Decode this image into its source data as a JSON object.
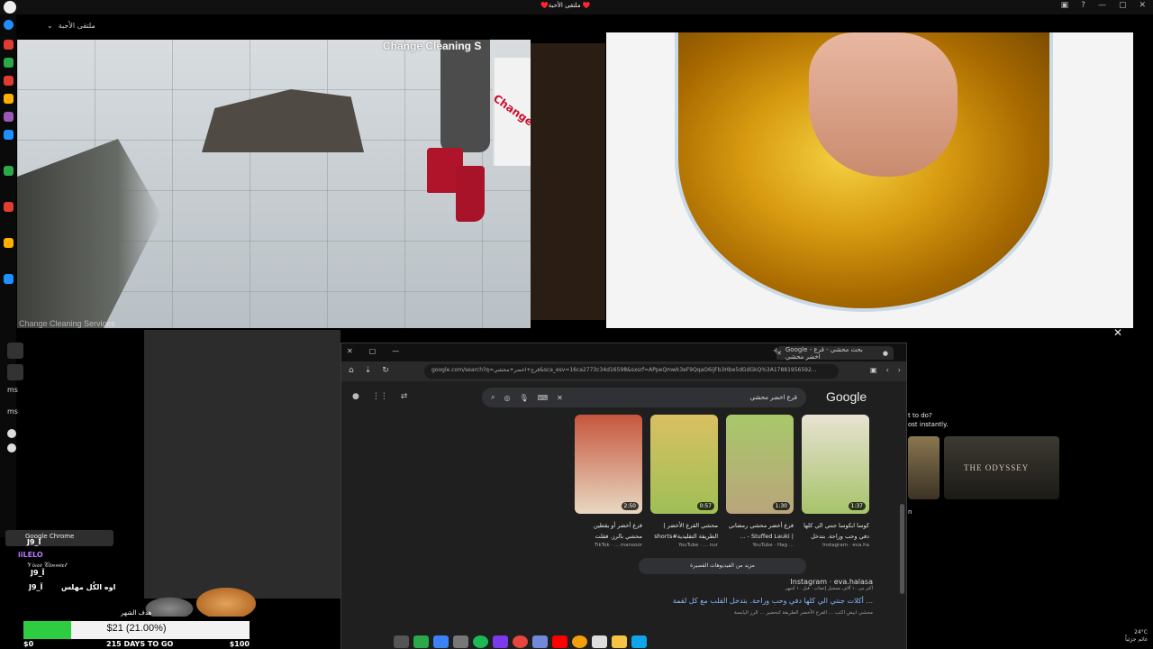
{
  "window": {
    "title": "♥️ملتقى الأحبة ♥️",
    "controls": [
      "▣",
      "?",
      "—",
      "▢",
      "✕"
    ]
  },
  "chat_header": {
    "room_name": "ملتقى الأحبة"
  },
  "video_left": {
    "brand_top": "Change Cleaning S",
    "sign_text": "Change Cle",
    "watermark": "Change Cleaning Services"
  },
  "browser": {
    "tab_title": "Google - بحث محشي - قرع اخضر محشي",
    "url": "google.com/search?q=قرع+اخضر+محشي&sca_esv=16ca2773c34d16598&sxsrf=APpeQmwk3eF9QqaO6ijFb3Hbe5dGdGkQ%3A17881956592...",
    "search_query": "قرع اخضر محشي",
    "logo": "Google",
    "videos": [
      {
        "title": "كوسا ابكوسا جنتي الي كلها دفي وحب وراحة. بتدخل القلب",
        "source": "Instagram · eva.ha",
        "duration": "1:37",
        "colors": [
          "#a7c36a",
          "#e8e2d2"
        ]
      },
      {
        "title": "قرع أخضر محشي رمضاني | Stuffed Lauki - ...",
        "source": "YouTube · Hag ... ",
        "duration": "1:30",
        "colors": [
          "#b9a57b",
          "#a8c86a"
        ]
      },
      {
        "title": "محشي القرع الأخضر | الطريقة التقليدية#shorts",
        "source": "YouTube · ... nur",
        "duration": "0:57",
        "colors": [
          "#9fbf56",
          "#d9c062"
        ]
      },
      {
        "title": "قرع أخضر أو يقطين محشي بالرز. فقلت البيتي...",
        "source": "TikTok · ... mansoor",
        "duration": "2:50",
        "colors": [
          "#e9d8c2",
          "#c5563c"
        ]
      }
    ],
    "more_videos": "مزيد من الفيديوهات القصيرة",
    "result": {
      "site": "Instagram · eva.halasa",
      "meta": "أكثر من ١٠ آلاف تسجيل إعجاب · قبل ١٠ أشهر",
      "link": "أكلات جنتي الي كلها دفي وحب وراحة. بتدخل القلب مع كل لقمة ...",
      "snippet": "محشي ابيض اكتب ... القرع الأخضر الطريقة لتحضير ... الرز اليابسة"
    }
  },
  "right_panel": {
    "text_lines": [
      "t to do?",
      "ost instantly."
    ],
    "thumb_title": "THE ODYSSEY",
    "letter": "n"
  },
  "overlay": {
    "chrome_label": "Google Chrome",
    "users": [
      "J9_Ï",
      "iiLELO",
      "J9_Ï",
      "J9_Ï"
    ],
    "lines": [
      "𝒱𝑜𝒾𝒸𝑒 𝒞𝑜𝓃𝓃𝑒𝒸𝓉",
      "اوه الكُل مهلس"
    ],
    "goal_title": "هدف الشهر",
    "goal_text": "$21 (21.00%)",
    "goal_fraction": 0.21,
    "goal_min": "$0",
    "goal_center": "215 DAYS TO GO",
    "goal_max": "$100"
  },
  "tray": {
    "temp": "24°C",
    "weather": "غائم جزئياً"
  },
  "colors": {
    "goal_fill": "#2ecc40",
    "link": "#8ab4f8",
    "boots": "#b0142a"
  }
}
